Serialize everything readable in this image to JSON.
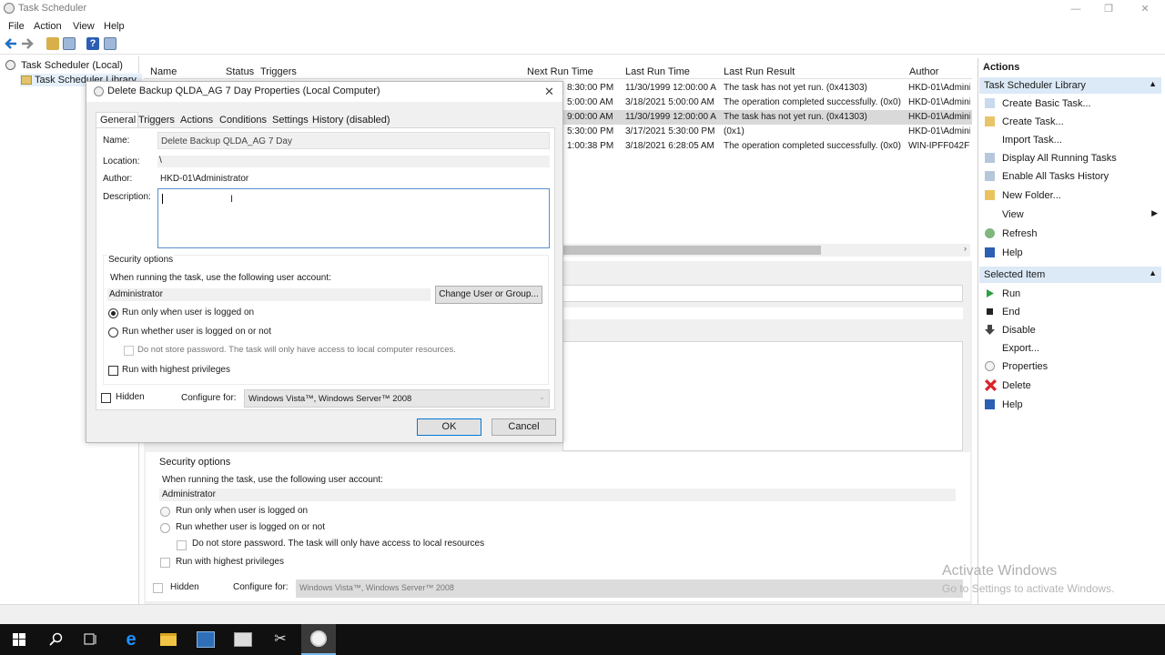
{
  "window": {
    "title": "Task Scheduler",
    "minimize": "—",
    "maximize": "❐",
    "close": "✕"
  },
  "menu": [
    "File",
    "Action",
    "View",
    "Help"
  ],
  "tree": {
    "root": "Task Scheduler (Local)",
    "library": "Task Scheduler Library"
  },
  "columns": {
    "name": "Name",
    "status": "Status",
    "triggers": "Triggers",
    "next_run": "Next Run Time",
    "last_run": "Last Run Time",
    "last_result": "Last Run Result",
    "author": "Author"
  },
  "rows": [
    {
      "next": "8:30:00 PM",
      "last": "11/30/1999 12:00:00 A...",
      "result": "The task has not yet run. (0x41303)",
      "author": "HKD-01\\Admini"
    },
    {
      "next": "5:00:00 AM",
      "last": "3/18/2021 5:00:00 AM",
      "result": "The operation completed successfully. (0x0)",
      "author": "HKD-01\\Admini"
    },
    {
      "next": "9:00:00 AM",
      "last": "11/30/1999 12:00:00 A...",
      "result": "The task has not yet run. (0x41303)",
      "author": "HKD-01\\Admini"
    },
    {
      "next": "5:30:00 PM",
      "last": "3/17/2021 5:30:00 PM",
      "result": "(0x1)",
      "author": "HKD-01\\Admini"
    },
    {
      "next": "1:00:38 PM",
      "last": "3/18/2021 6:28:05 AM",
      "result": "The operation completed successfully. (0x0)",
      "author": "WIN-IPFF042FLI"
    }
  ],
  "actions_panel": {
    "header": "Actions",
    "section1": "Task Scheduler Library",
    "items1": [
      "Create Basic Task...",
      "Create Task...",
      "Import Task...",
      "Display All Running Tasks",
      "Enable All Tasks History",
      "New Folder...",
      "View",
      "Refresh",
      "Help"
    ],
    "section2": "Selected Item",
    "items2": [
      "Run",
      "End",
      "Disable",
      "Export...",
      "Properties",
      "Delete",
      "Help"
    ]
  },
  "background_detail": {
    "security_options": "Security options",
    "when_running": "When running the task, use the following user account:",
    "account": "Administrator",
    "run_only": "Run only when user is logged on",
    "run_whether": "Run whether user is logged on or not",
    "no_store": "Do not store password.  The task will only have access to local resources",
    "highest": "Run with highest privileges",
    "hidden": "Hidden",
    "configure_for": "Configure for:",
    "configure_value": "Windows Vista™, Windows Server™ 2008"
  },
  "dialog": {
    "title": "Delete Backup QLDA_AG 7 Day Properties (Local Computer)",
    "tabs": [
      "General",
      "Triggers",
      "Actions",
      "Conditions",
      "Settings",
      "History (disabled)"
    ],
    "name_label": "Name:",
    "name_value": "Delete Backup QLDA_AG 7 Day",
    "location_label": "Location:",
    "location_value": "\\",
    "author_label": "Author:",
    "author_value": "HKD-01\\Administrator",
    "description_label": "Description:",
    "description_value": "",
    "security_options": "Security options",
    "when_running": "When running the task, use the following user account:",
    "account": "Administrator",
    "change_user": "Change User or Group...",
    "run_only": "Run only when user is logged on",
    "run_whether": "Run whether user is logged on or not",
    "no_store": "Do not store password.  The task will only have access to local computer resources.",
    "highest": "Run with highest privileges",
    "hidden": "Hidden",
    "configure_for": "Configure for:",
    "configure_value": "Windows Vista™, Windows Server™ 2008",
    "ok": "OK",
    "cancel": "Cancel"
  },
  "watermark": {
    "line1": "Activate Windows",
    "line2": "Go to Settings to activate Windows."
  }
}
